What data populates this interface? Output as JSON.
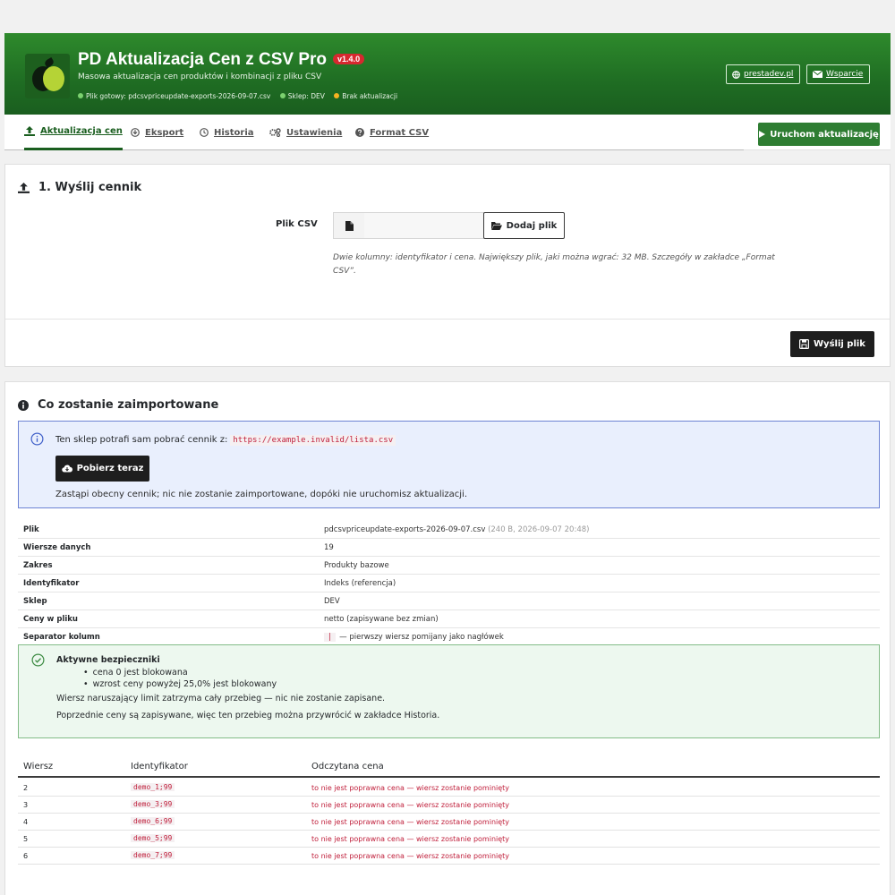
{
  "header": {
    "title": "PD Aktualizacja Cen z CSV Pro",
    "version": "v1.4.0",
    "subtitle": "Masowa aktualizacja cen produktów i kombinacji z pliku CSV",
    "status": {
      "file_ready": "Plik gotowy: pdcsvpriceupdate-exports-2026-09-07.csv",
      "shop": "Sklep: DEV",
      "no_update": "Brak aktualizacji"
    },
    "link_site": "prestadev.pl",
    "link_support": "Wsparcie"
  },
  "tabs": {
    "update": "Aktualizacja cen",
    "export": "Eksport",
    "history": "Historia",
    "settings": "Ustawienia",
    "format": "Format CSV"
  },
  "run_button": "Uruchom aktualizację",
  "upload": {
    "title": "1. Wyślij cennik",
    "label": "Plik CSV",
    "add_button": "Dodaj plik",
    "hint": "Dwie kolumny: identyfikator i cena. Największy plik, jaki można wgrać: 32 MB. Szczegóły w zakładce „Format CSV”.",
    "send_button": "Wyślij plik"
  },
  "import": {
    "title": "Co zostanie zaimportowane",
    "info_text": "Ten sklep potrafi sam pobrać cennik z:",
    "info_url": "https://example.invalid/lista.csv",
    "fetch_button": "Pobierz teraz",
    "info_note": "Zastąpi obecny cennik; nic nie zostanie zaimportowane, dopóki nie uruchomisz aktualizacji.",
    "details": {
      "file_k": "Plik",
      "file_v": "pdcsvpriceupdate-exports-2026-09-07.csv",
      "file_meta": "(240 B, 2026-09-07 20:48)",
      "rows_k": "Wiersze danych",
      "rows_v": "19",
      "scope_k": "Zakres",
      "scope_v": "Produkty bazowe",
      "ident_k": "Identyfikator",
      "ident_v": "Indeks (referencja)",
      "shop_k": "Sklep",
      "shop_v": "DEV",
      "prices_k": "Ceny w pliku",
      "prices_v": "netto (zapisywane bez zmian)",
      "sep_k": "Separator kolumn",
      "sep_char": "|",
      "sep_v": "— pierwszy wiersz pomijany jako nagłówek"
    },
    "safeguards": {
      "title": "Aktywne bezpieczniki",
      "item1": "cena 0 jest blokowana",
      "item2": "wzrost ceny powyżej 25,0% jest blokowany",
      "line2": "Wiersz naruszający limit zatrzyma cały przebieg — nic nie zostanie zapisane.",
      "line3": "Poprzednie ceny są zapisywane, więc ten przebieg można przywrócić w zakładce Historia."
    },
    "table": {
      "col_row": "Wiersz",
      "col_id": "Identyfikator",
      "col_price": "Odczytana cena",
      "rows": [
        {
          "row": "2",
          "id": "demo_1;99",
          "price": "to nie jest poprawna cena — wiersz zostanie pominięty"
        },
        {
          "row": "3",
          "id": "demo_3;99",
          "price": "to nie jest poprawna cena — wiersz zostanie pominięty"
        },
        {
          "row": "4",
          "id": "demo_6;99",
          "price": "to nie jest poprawna cena — wiersz zostanie pominięty"
        },
        {
          "row": "5",
          "id": "demo_5;99",
          "price": "to nie jest poprawna cena — wiersz zostanie pominięty"
        },
        {
          "row": "6",
          "id": "demo_7;99",
          "price": "to nie jest poprawna cena — wiersz zostanie pominięty"
        }
      ]
    }
  },
  "colors": {
    "brand_green": "#1a5e1f",
    "version_badge": "#d7282f",
    "run_button": "#2e7d32",
    "error_text": "#c0203c"
  }
}
